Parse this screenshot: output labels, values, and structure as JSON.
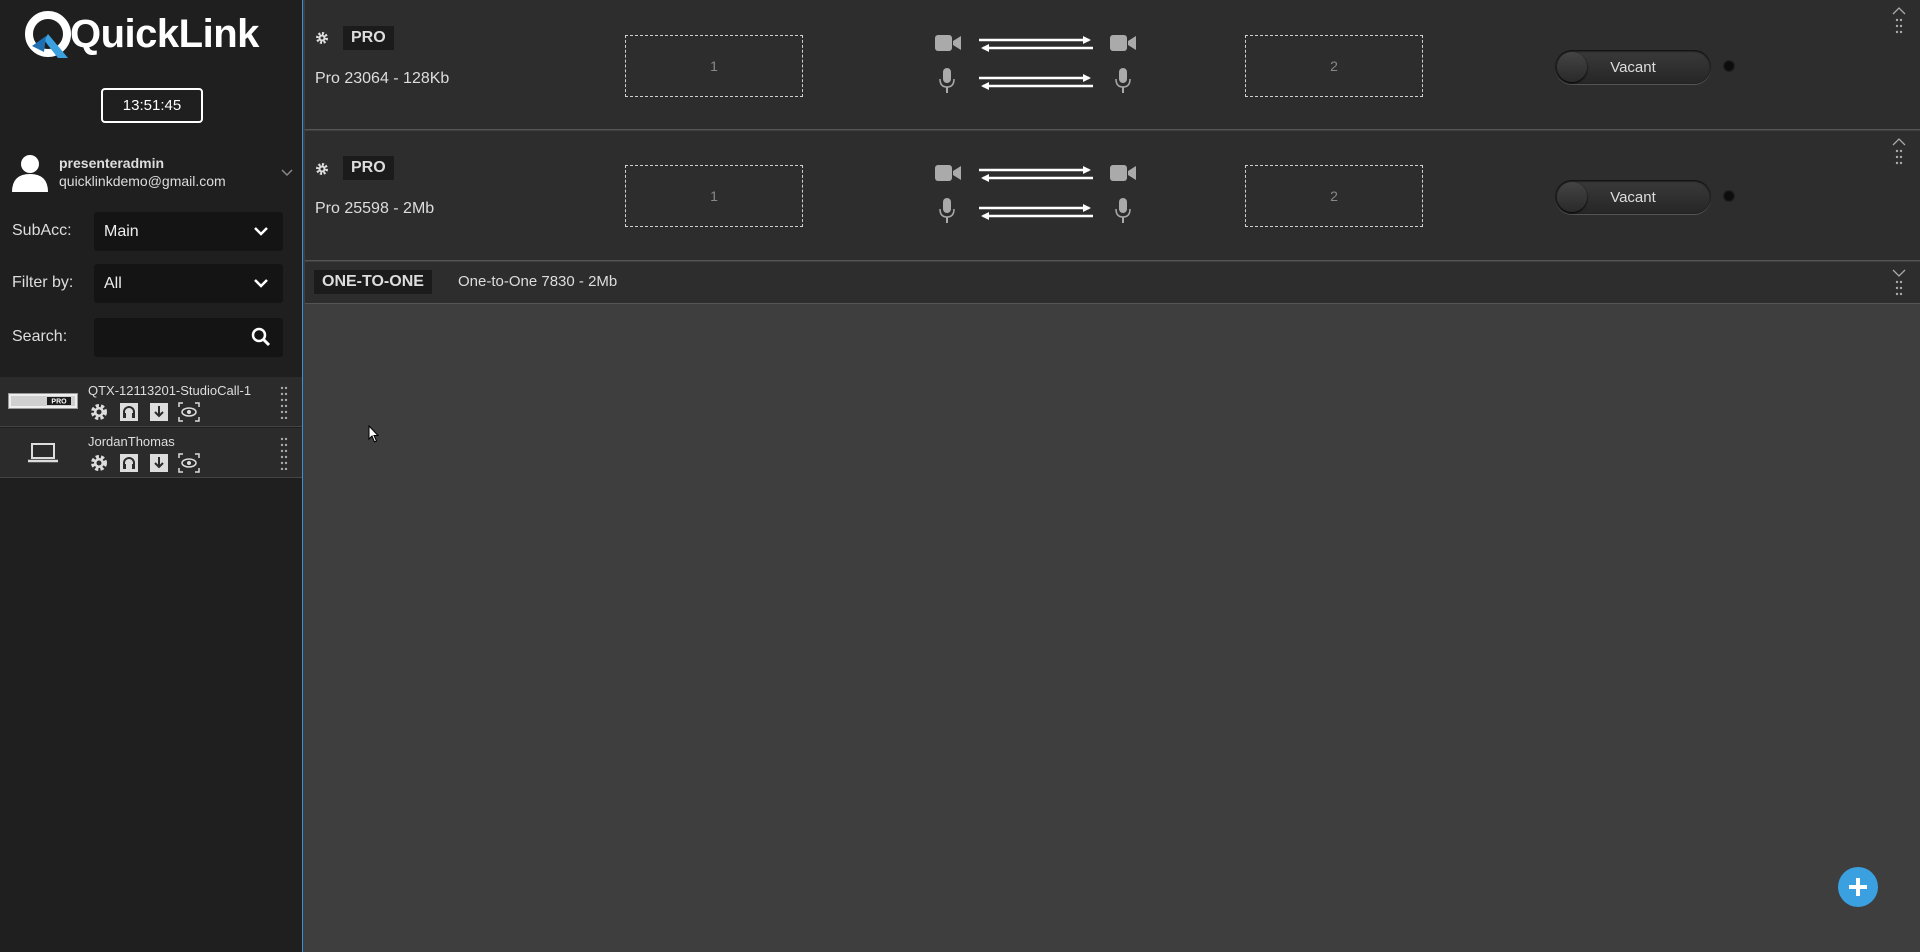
{
  "brand": {
    "name": "QuickLink"
  },
  "clock": "13:51:45",
  "user": {
    "name": "presenteradmin",
    "email": "quicklinkdemo@gmail.com"
  },
  "filters": {
    "subacc_label": "SubAcc:",
    "subacc_value": "Main",
    "filter_label": "Filter by:",
    "filter_value": "All",
    "search_label": "Search:",
    "search_value": ""
  },
  "devices": [
    {
      "name": "QTX-12113201-StudioCall-1",
      "type": "pro-hardware",
      "thumb_label": "PRO"
    },
    {
      "name": "JordanThomas",
      "type": "laptop"
    }
  ],
  "sessions": [
    {
      "badge": "PRO",
      "title": "Pro 23064 - 128Kb",
      "slot_a": "1",
      "slot_b": "2",
      "status": "Vacant",
      "expanded": true
    },
    {
      "badge": "PRO",
      "title": "Pro 25598 - 2Mb",
      "slot_a": "1",
      "slot_b": "2",
      "status": "Vacant",
      "expanded": true
    },
    {
      "badge": "ONE-TO-ONE",
      "title": "One-to-One 7830 - 2Mb",
      "expanded": false
    }
  ],
  "colors": {
    "accent": "#3aa0e0",
    "sidebar_bg": "#1f1f1f",
    "panel_bg": "#2d2d2d",
    "main_bg": "#3f3e3f"
  },
  "icons": [
    "gear-icon",
    "video-camera-icon",
    "microphone-icon",
    "bidirectional-arrows-icon",
    "headphones-icon",
    "download-icon",
    "eye-icon",
    "search-icon",
    "chevron-down-icon",
    "grip-icon",
    "add-icon"
  ]
}
